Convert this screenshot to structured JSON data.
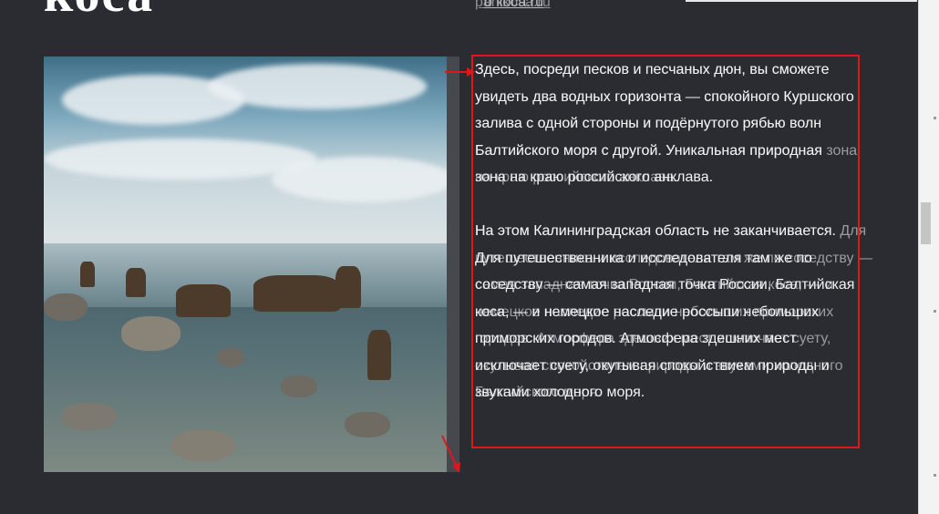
{
  "page": {
    "heading": "коса",
    "top_link": "panikosa.ru",
    "top_link_ghost": "о коса.ru"
  },
  "description": {
    "ghost_paragraph_1": "Здесь, посреди песков и песчаных дюн, вы сможете увидеть два водных горизонта — спокойного Куршского залива с одной стороны и подёрнутого рябью волн Балтийского моря с другой. Уникальная природная зона на краю российского анклава.",
    "ghost_paragraph_2": "На этом Калининградская область не заканчивается. Для путешественника и исследователя там же по соседству — самая западная точка России, Балтийская коса, — и немецкое наследие россыпи небольших приморских городов. Атмосфера здешних мест исключает суету, окутывая спокойствием природы и звуками холодного Балтийского моря.",
    "main_paragraph_1": "Здесь, посреди песков и песчаных дюн, вы сможете увидеть два водных горизонта — спокойного Куршского залива с одной стороны и подёрнутого рябью волн Балтийского моря с другой. Уникальная природная зона на краю российского анклава.",
    "main_paragraph_2": "На этом Калининградская область не заканчивается. Для путешественника и исследователя там же по соседству — самая западная точка России, Балтийская коса, — и немецкое наследие россыпи небольших приморских городов. Атмосфера здешних мест исключает суету, окутывая спокойствием природы и звуками холодного моря."
  },
  "colors": {
    "background": "#2b2c31",
    "annotation": "#e3151b"
  },
  "icons": {
    "arrow_top": "arrow-right-icon",
    "arrow_bottom": "arrow-down-right-icon"
  }
}
